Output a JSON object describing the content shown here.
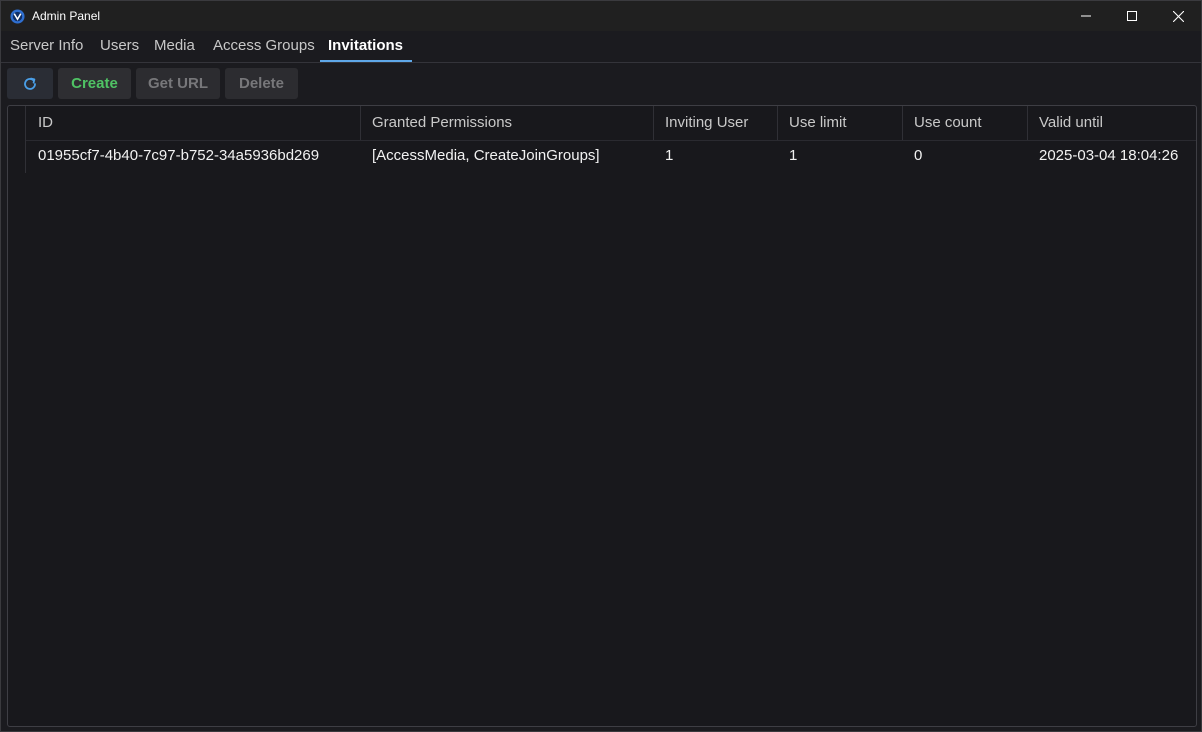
{
  "window": {
    "title": "Admin Panel",
    "icon": "app-logo-icon"
  },
  "tabs": [
    {
      "label": "Server Info",
      "active": false
    },
    {
      "label": "Users",
      "active": false
    },
    {
      "label": "Media",
      "active": false
    },
    {
      "label": "Access Groups",
      "active": false
    },
    {
      "label": "Invitations",
      "active": true
    }
  ],
  "toolbar": {
    "refresh_icon": "refresh-icon",
    "create_label": "Create",
    "get_url_label": "Get URL",
    "delete_label": "Delete"
  },
  "table": {
    "columns": [
      "ID",
      "Granted Permissions",
      "Inviting User",
      "Use limit",
      "Use count",
      "Valid until"
    ],
    "rows": [
      {
        "id": "01955cf7-4b40-7c97-b752-34a5936bd269",
        "permissions": "[AccessMedia, CreateJoinGroups]",
        "inviting_user": "1",
        "use_limit": "1",
        "use_count": "0",
        "valid_until": "2025-03-04 18:04:26"
      }
    ]
  },
  "colors": {
    "accent": "#5fa8e8",
    "create_green": "#4fc264",
    "disabled_text": "#77777a"
  }
}
